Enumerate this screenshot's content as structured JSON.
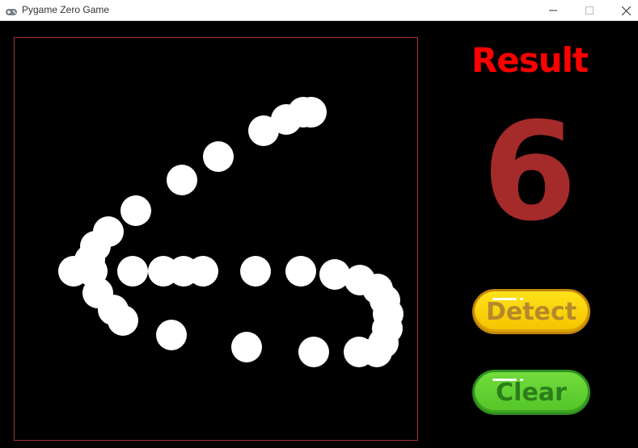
{
  "window": {
    "title": "Pygame Zero Game",
    "icon": "gamepad-icon",
    "controls": [
      "minimize-icon",
      "maximize-icon",
      "close-icon"
    ]
  },
  "canvas": {
    "background": "#000000",
    "border_color": "#a0342e",
    "stroke_color": "#ffffff"
  },
  "result": {
    "label": "Result",
    "value": "6",
    "label_color": "#ff0000",
    "value_color": "#a52a2a"
  },
  "buttons": {
    "detect_label": "Detect",
    "clear_label": "Clear",
    "detect_color": "#ffd700",
    "clear_color": "#5ccc2e"
  }
}
